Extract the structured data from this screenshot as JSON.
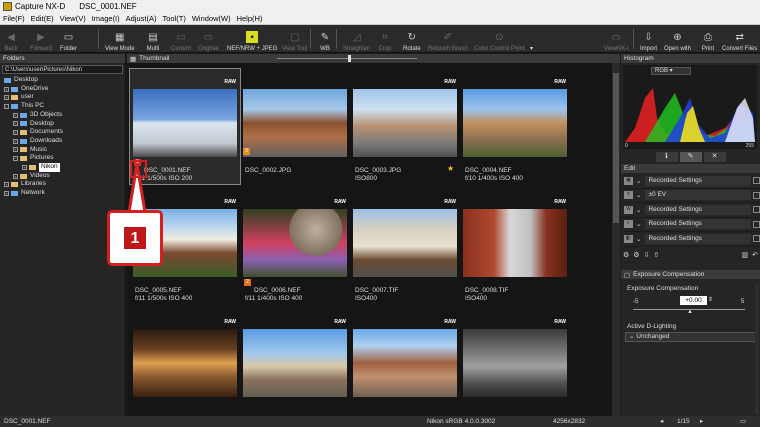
{
  "window": {
    "title": "Capture NX-D",
    "file": "DSC_0001.NEF"
  },
  "menu": [
    "File(F)",
    "Edit(E)",
    "View(V)",
    "Image(I)",
    "Adjust(A)",
    "Tool(T)",
    "Window(W)",
    "Help(H)"
  ],
  "toolbar": {
    "back": "Back",
    "forward": "Forward",
    "folder": "Folder",
    "view_mode": "View Mode",
    "multi": "Multi",
    "current": "Current",
    "original": "Original",
    "nef_jpeg": "NEF/NRW + JPEG",
    "view_tool": "View Tool",
    "wb": "WB",
    "straighten": "Straighten",
    "crop": "Crop",
    "rotate": "Rotate",
    "retouch": "Retouch Brush",
    "color_point": "Color Control Point",
    "viewnx": "ViewNX-i",
    "import": "Import",
    "open_with": "Open with",
    "print": "Print",
    "convert": "Convert Files"
  },
  "folders": {
    "header": "Folders",
    "path": "C:\\Users\\user\\Pictures\\Nikon",
    "items": [
      "Desktop",
      "OneDrive",
      "user",
      "This PC",
      "3D Objects",
      "Desktop",
      "Documents",
      "Downloads",
      "Music",
      "Pictures",
      "Nikon",
      "Videos",
      "Libraries",
      "Network"
    ]
  },
  "thumbs_header": "Thumbnail",
  "thumbs": [
    {
      "name": "DSC_0001.NEF",
      "info": "f/11 1/500s ISO 200",
      "raw": "RAW",
      "badge": "1",
      "badge_color": "#d03030"
    },
    {
      "name": "DSC_0002.JPG",
      "info": "",
      "raw": "",
      "badge": "3",
      "badge_color": "#e09020"
    },
    {
      "name": "DSC_0003.JPG",
      "info": "ISO800",
      "raw": "RAW",
      "star": "★"
    },
    {
      "name": "DSC_0004.NEF",
      "info": "f/10 1/400s ISO 400",
      "raw": "RAW"
    },
    {
      "name": "DSC_0005.NEF",
      "info": "f/11 1/500s ISO 400",
      "raw": "RAW"
    },
    {
      "name": "DSC_0006.NEF",
      "info": "f/11 1/400s ISO 400",
      "raw": "RAW",
      "badge": "2",
      "badge_color": "#e07020"
    },
    {
      "name": "DSC_0007.TIF",
      "info": "ISO400",
      "raw": "RAW"
    },
    {
      "name": "DSC_0008.TIF",
      "info": "ISO400",
      "raw": "RAW"
    },
    {
      "name": "",
      "info": "",
      "raw": "RAW"
    },
    {
      "name": "",
      "info": "",
      "raw": "RAW"
    },
    {
      "name": "",
      "info": "",
      "raw": "RAW"
    },
    {
      "name": "",
      "info": "",
      "raw": "RAW"
    }
  ],
  "histogram": {
    "header": "Histogram",
    "channel": "RGB",
    "min": "0",
    "max": "255"
  },
  "edit": {
    "header": "Edit",
    "rows": [
      "Recorded Settings",
      "±0 EV",
      "Recorded Settings",
      "Recorded Settings",
      "Recorded Settings"
    ]
  },
  "exposure": {
    "header": "Exposure Compensation",
    "label": "Exposure Compensation",
    "value": "+0.00",
    "ticks": [
      "-5",
      "0",
      "5"
    ],
    "adl_label": "Active D-Lighting",
    "adl_value": "Unchanged"
  },
  "status": {
    "file": "DSC_0001.NEF",
    "profile": "Nikon sRGB 4.0.0.3002",
    "size": "4256x2832",
    "page": "1/15"
  },
  "callout": "1"
}
